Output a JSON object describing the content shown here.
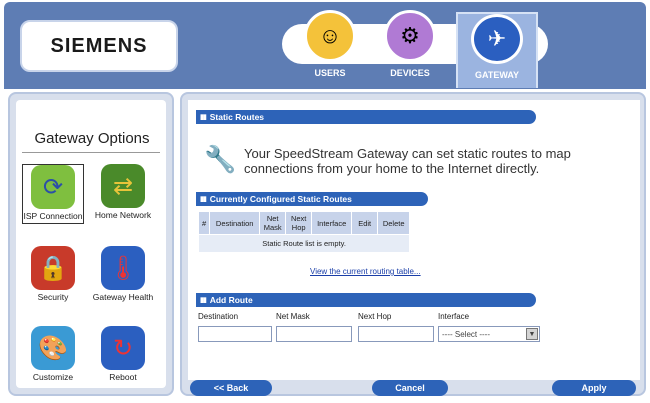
{
  "brand": {
    "logo": "SIEMENS"
  },
  "nav": {
    "tabs": [
      {
        "label": "USERS",
        "icon": "users-icon"
      },
      {
        "label": "DEVICES",
        "icon": "devices-icon"
      },
      {
        "label": "GATEWAY",
        "icon": "gateway-icon",
        "active": true
      }
    ]
  },
  "sidebar": {
    "title": "Gateway Options",
    "items": [
      {
        "label": "ISP Connection",
        "icon": "isp-connection-icon",
        "selected": true
      },
      {
        "label": "Home Network",
        "icon": "home-network-icon"
      },
      {
        "label": "Security",
        "icon": "security-icon"
      },
      {
        "label": "Gateway Health",
        "icon": "gateway-health-icon"
      },
      {
        "label": "Customize",
        "icon": "customize-icon"
      },
      {
        "label": "Reboot",
        "icon": "reboot-icon"
      }
    ]
  },
  "main": {
    "static_routes_header": "Static Routes",
    "intro": "Your SpeedStream Gateway can set static routes to map connections from your home to the Internet directly.",
    "configured_header": "Currently Configured Static Routes",
    "table": {
      "columns": [
        "#",
        "Destination",
        "Net Mask",
        "Next Hop",
        "Interface",
        "Edit",
        "Delete"
      ],
      "empty_message": "Static Route list is empty."
    },
    "routing_link": "View the current routing table...",
    "add_route_header": "Add Route",
    "fields": {
      "destination_label": "Destination",
      "net_mask_label": "Net Mask",
      "next_hop_label": "Next Hop",
      "interface_label": "Interface",
      "interface_value": "---- Select ----"
    }
  },
  "buttons": {
    "back": "<< Back",
    "cancel": "Cancel",
    "apply": "Apply"
  },
  "colors": {
    "header": "#5e7db4",
    "section_bar": "#2d63b8",
    "panel": "#d8dfec"
  }
}
